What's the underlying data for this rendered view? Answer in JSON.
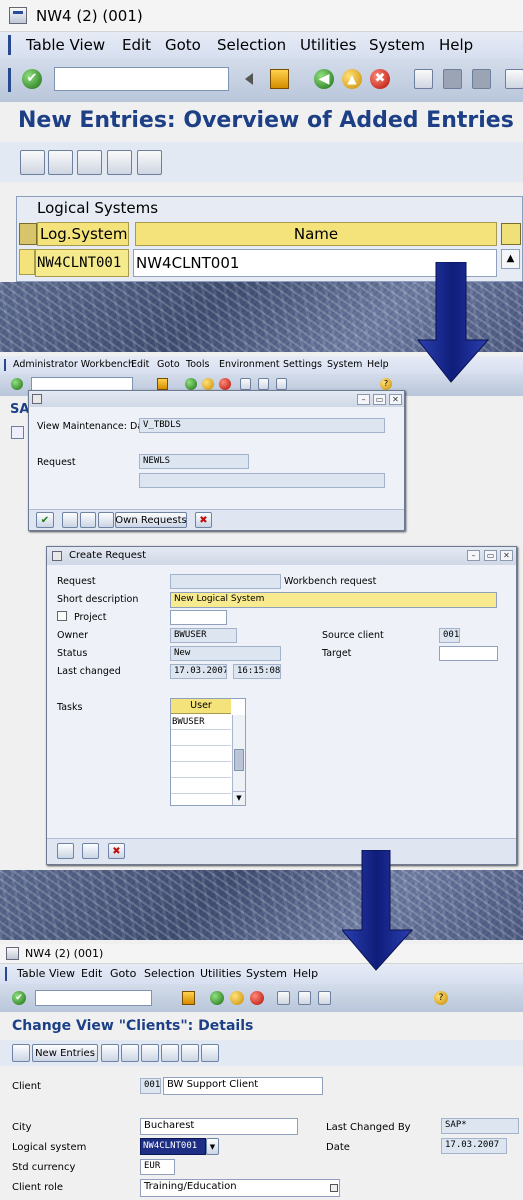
{
  "top": {
    "title": "NW4 (2) (001)",
    "menu": [
      "Table View",
      "Edit",
      "Goto",
      "Selection",
      "Utilities",
      "System",
      "Help"
    ],
    "heading": "New Entries: Overview of Added Entries",
    "table": {
      "caption": "Logical Systems",
      "col_system": "Log.System",
      "col_name": "Name",
      "row_system": "NW4CLNT001",
      "row_name": "NW4CLNT001"
    }
  },
  "middle": {
    "menu": [
      "Administrator Workbench",
      "Edit",
      "Goto",
      "Tools",
      "Environment",
      "Settings",
      "System",
      "Help"
    ],
    "bg_heading": "SA",
    "dialog1": {
      "view_label": "View Maintenance: Dat",
      "view_value": "V_TBDLS",
      "request_label": "Request",
      "request_value": "NEWLS",
      "own_requests": "Own Requests"
    },
    "dialog2": {
      "title": "Create Request",
      "request_label": "Request",
      "workbench_label": "Workbench request",
      "short_desc_label": "Short description",
      "short_desc_value": "New Logical System",
      "project_label": "Project",
      "owner_label": "Owner",
      "owner_value": "BWUSER",
      "source_client_label": "Source client",
      "source_client_value": "001",
      "status_label": "Status",
      "status_value": "New",
      "target_label": "Target",
      "last_changed_label": "Last changed",
      "last_changed_date": "17.03.2007",
      "last_changed_time": "16:15:08",
      "tasks_label": "Tasks",
      "user_col": "User",
      "user_row": "BWUSER"
    }
  },
  "bottom": {
    "title": "NW4 (2) (001)",
    "menu": [
      "Table View",
      "Edit",
      "Goto",
      "Selection",
      "Utilities",
      "System",
      "Help"
    ],
    "heading": "Change View \"Clients\": Details",
    "new_entries": "New Entries",
    "client_label": "Client",
    "client_value": "001",
    "client_name": "BW Support Client",
    "city_label": "City",
    "city_value": "Bucharest",
    "last_changed_by_label": "Last Changed By",
    "last_changed_by_value": "SAP*",
    "logical_system_label": "Logical system",
    "logical_system_value": "NW4CLNT001",
    "date_label": "Date",
    "date_value": "17.03.2007",
    "currency_label": "Std currency",
    "currency_value": "EUR",
    "role_label": "Client role",
    "role_value": "Training/Education"
  },
  "colors": {
    "heading_blue": "#1d3f86",
    "arrow_blue": "#1b2f9c",
    "highlight_yellow": "#f5eb8c"
  }
}
